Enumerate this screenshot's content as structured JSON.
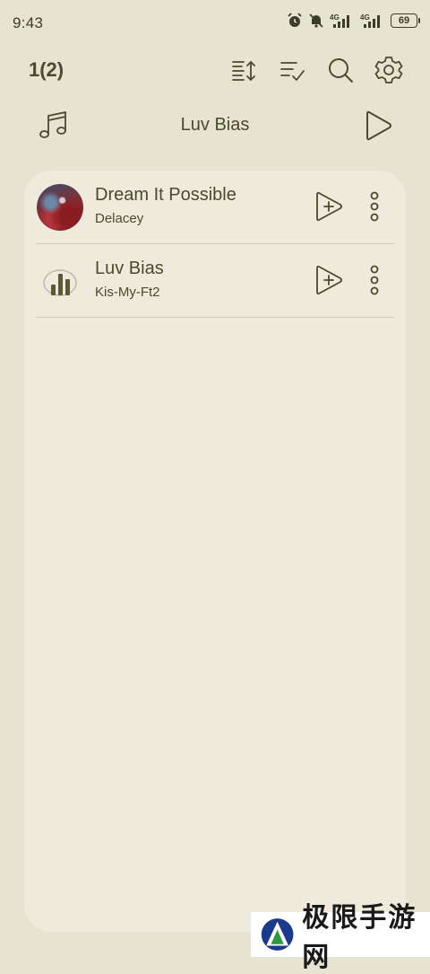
{
  "status_bar": {
    "time": "9:43",
    "battery": "69",
    "icons": [
      "alarm-icon",
      "bell-off-icon",
      "signal-4g-icon",
      "signal-4g-icon",
      "battery-icon"
    ],
    "network_label_1": "4G",
    "network_label_2": "4G"
  },
  "header": {
    "count_title": "1(2)",
    "actions": [
      "sort-icon",
      "multi-select-icon",
      "search-icon",
      "settings-icon"
    ]
  },
  "now_playing": {
    "title": "Luv Bias",
    "left_icon": "music-note-icon",
    "right_icon": "play-icon"
  },
  "songs": [
    {
      "title": "Dream It Possible",
      "artist": "Delacey"
    },
    {
      "title": "Luv Bias",
      "artist": "Kis-My-Ft2"
    }
  ],
  "watermark": {
    "text": "极限手游网"
  },
  "colors": {
    "background": "#e6e3d0",
    "card": "#eeebdd",
    "text": "#4a4a2c"
  }
}
